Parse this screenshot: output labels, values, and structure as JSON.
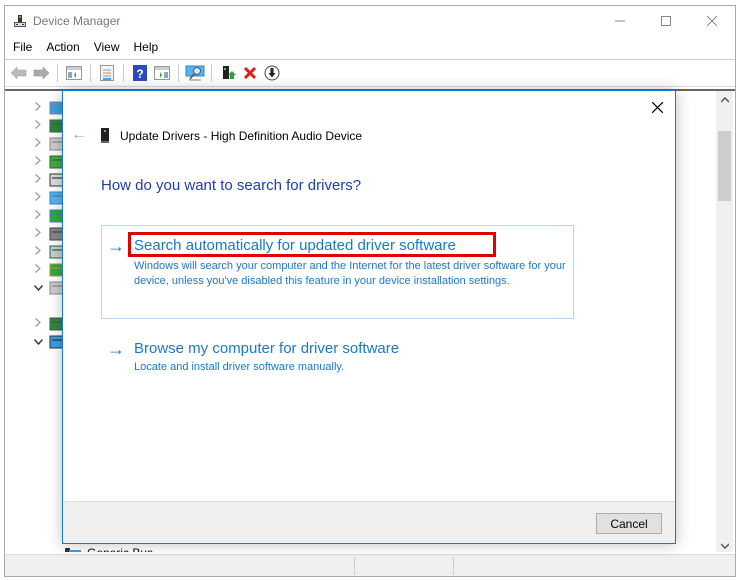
{
  "window": {
    "title": "Device Manager",
    "controls": {
      "minimize": "—",
      "maximize": "☐",
      "close": "✕"
    }
  },
  "menu": [
    "File",
    "Action",
    "View",
    "Help"
  ],
  "toolbar": {
    "buttons": [
      {
        "name": "back-icon"
      },
      {
        "name": "forward-icon"
      },
      {
        "name": "show-hide-console-tree-icon"
      },
      {
        "name": "properties-icon"
      },
      {
        "name": "help-icon"
      },
      {
        "name": "show-hide-action-pane-icon"
      },
      {
        "name": "scan-hardware-icon"
      },
      {
        "name": "update-driver-icon"
      },
      {
        "name": "uninstall-icon"
      },
      {
        "name": "disable-device-icon"
      }
    ]
  },
  "tree": {
    "rows": [
      {
        "expanded": false,
        "icon": "human-interface-icon"
      },
      {
        "expanded": false,
        "icon": "ide-controller-icon"
      },
      {
        "expanded": false,
        "icon": "keyboard-icon"
      },
      {
        "expanded": false,
        "icon": "memory-icon"
      },
      {
        "expanded": false,
        "icon": "mouse-icon"
      },
      {
        "expanded": false,
        "icon": "monitor-icon"
      },
      {
        "expanded": false,
        "icon": "network-adapter-icon"
      },
      {
        "expanded": false,
        "icon": "ports-icon"
      },
      {
        "expanded": false,
        "icon": "processor-icon"
      },
      {
        "expanded": false,
        "icon": "software-device-icon"
      },
      {
        "expanded": true,
        "icon": "sound-icon"
      },
      {
        "expanded": false,
        "icon": "storage-controller-icon"
      },
      {
        "expanded": true,
        "icon": "system-devices-icon"
      }
    ],
    "partial_item": "Generic Bus"
  },
  "dialog": {
    "title": "Update Drivers - High Definition Audio Device",
    "heading": "How do you want to search for drivers?",
    "options": [
      {
        "title": "Search automatically for updated driver software",
        "description": "Windows will search your computer and the Internet for the latest driver software for your device, unless you've disabled this feature in your device installation settings.",
        "highlighted": true
      },
      {
        "title": "Browse my computer for driver software",
        "description": "Locate and install driver software manually.",
        "highlighted": false
      }
    ],
    "cancel_label": "Cancel",
    "close_glyph": "✕",
    "back_glyph": "←",
    "arrow_glyph": "→"
  },
  "colors": {
    "accent": "#1979ca",
    "heading": "#1e3ea8",
    "highlight": "#e00000"
  }
}
